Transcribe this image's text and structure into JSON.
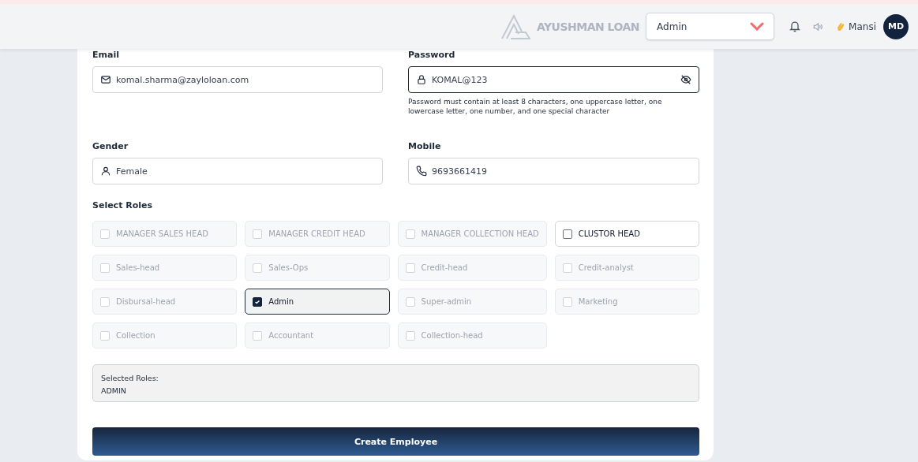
{
  "header": {
    "brand": "AYUSHMAN LOAN",
    "role_select": {
      "value": "Admin"
    },
    "user_name": "Mansi",
    "avatar_initials": "MD"
  },
  "form": {
    "fields": [
      {
        "label": "Email",
        "value": "komal.sharma@zayloloan.com",
        "focused": false
      },
      {
        "label": "Password",
        "value": "KOMAL@123",
        "focused": true,
        "hint": "Password must contain at least 8 characters, one uppercase letter, one lowercase letter, one number, and one special character"
      },
      {
        "label": "Gender",
        "value": "Female",
        "focused": false
      },
      {
        "label": "Mobile",
        "value": "9693661419",
        "focused": false
      }
    ],
    "roles_label": "Select Roles",
    "roles": [
      {
        "label": "MANAGER SALES HEAD",
        "checked": false,
        "disabled": true
      },
      {
        "label": "MANAGER CREDIT HEAD",
        "checked": false,
        "disabled": true
      },
      {
        "label": "MANAGER COLLECTION HEAD",
        "checked": false,
        "disabled": true
      },
      {
        "label": "CLUSTOR HEAD",
        "checked": false,
        "disabled": false
      },
      {
        "label": "Sales-head",
        "checked": false,
        "disabled": true
      },
      {
        "label": "Sales-Ops",
        "checked": false,
        "disabled": true
      },
      {
        "label": "Credit-head",
        "checked": false,
        "disabled": true
      },
      {
        "label": "Credit-analyst",
        "checked": false,
        "disabled": true
      },
      {
        "label": "Disbursal-head",
        "checked": false,
        "disabled": true
      },
      {
        "label": "Admin",
        "checked": true,
        "disabled": false
      },
      {
        "label": "Super-admin",
        "checked": false,
        "disabled": true
      },
      {
        "label": "Marketing",
        "checked": false,
        "disabled": true
      },
      {
        "label": "Collection",
        "checked": false,
        "disabled": true
      },
      {
        "label": "Accountant",
        "checked": false,
        "disabled": true
      },
      {
        "label": "Collection-head",
        "checked": false,
        "disabled": true
      }
    ],
    "selected_roles": {
      "title": "Selected Roles:",
      "value": "ADMIN"
    },
    "submit": "Create Employee"
  }
}
